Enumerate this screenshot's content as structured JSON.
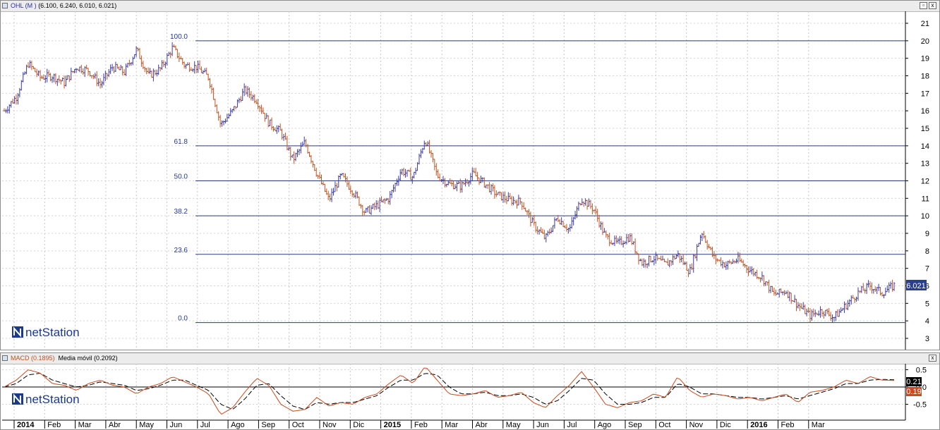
{
  "main_panel": {
    "title_symbol": "OHL (M )",
    "title_values": "(6.100, 6.240, 6.010, 6.021)",
    "last_price_badge": "6.021",
    "logo_text": "netStation",
    "y_ticks": [
      "21",
      "20",
      "19",
      "18",
      "17",
      "16",
      "15",
      "14",
      "13",
      "12",
      "11",
      "10",
      "9",
      "8",
      "7",
      "6",
      "5",
      "4",
      "3"
    ]
  },
  "macd_panel": {
    "title_macd": "MACD (0.1895)",
    "title_ma": "Media móvil (0.2092)",
    "badge_signal": "0.21",
    "badge_macd": "0.19",
    "logo_text": "netStation",
    "y_ticks": [
      "0.5",
      "0.0",
      "-0.5"
    ]
  },
  "window_buttons": {
    "restore": "▫",
    "close": "x"
  },
  "colors": {
    "up_bar": "#3a3aa8",
    "down_bar": "#c0531f",
    "fib_line": "#2b3c78",
    "macd_line": "#cc4a1c",
    "signal_line": "#000000",
    "badge": "#2b3d8f"
  },
  "chart_data": [
    {
      "type": "ohlc",
      "x_axis": "date (2014-01 to 2016-03)",
      "x_labels": [
        "2014",
        "Feb",
        "Mar",
        "Abr",
        "May",
        "Jun",
        "Jul",
        "Ago",
        "Sep",
        "Oct",
        "Nov",
        "Dic",
        "2015",
        "Feb",
        "Mar",
        "Abr",
        "May",
        "Jun",
        "Jul",
        "Ago",
        "Sep",
        "Oct",
        "Nov",
        "Dic",
        "2016",
        "Feb",
        "Mar"
      ],
      "ylim": [
        3,
        21
      ],
      "last_close": 6.021,
      "series_close": [
        16,
        16.8,
        18.7,
        17.9,
        18,
        17.6,
        18.5,
        18.3,
        17.5,
        18.5,
        18.2,
        19.5,
        18,
        18.4,
        19.6,
        18.6,
        18.5,
        17.9,
        15.2,
        16,
        17.2,
        16.6,
        15.3,
        14.8,
        13.2,
        14.2,
        12.4,
        10.9,
        12.3,
        11.4,
        10.2,
        10.6,
        11,
        12.6,
        12.2,
        14.4,
        12.3,
        11.8,
        11.7,
        12.4,
        11.8,
        11.2,
        10.9,
        10.8,
        9.5,
        8.7,
        9.9,
        9.2,
        11.0,
        10.4,
        8.8,
        8.4,
        8.8,
        7.3,
        7.6,
        7.2,
        7.8,
        6.8,
        9.1,
        7.6,
        7.2,
        7.5,
        6.9,
        6.5,
        5.5,
        5.7,
        4.9,
        4.3,
        4.6,
        4.2,
        4.9,
        5.6,
        6.0,
        5.6,
        6.021
      ],
      "fibonacci_levels": [
        {
          "label": "100.0",
          "price": 20.0
        },
        {
          "label": "61.8",
          "price": 14.0
        },
        {
          "label": "50.0",
          "price": 12.0
        },
        {
          "label": "38.2",
          "price": 10.0
        },
        {
          "label": "23.6",
          "price": 7.8
        },
        {
          "label": "0.0",
          "price": 3.9
        }
      ]
    },
    {
      "type": "line",
      "ylim": [
        -1.0,
        0.8
      ],
      "series": [
        {
          "name": "MACD (0.1895)",
          "values": [
            0.0,
            0.2,
            0.5,
            0.4,
            0.1,
            0.05,
            -0.1,
            0.1,
            0.2,
            0.05,
            0.0,
            -0.2,
            0.0,
            0.1,
            0.3,
            0.15,
            0.0,
            -0.2,
            -0.8,
            -0.6,
            -0.15,
            0.25,
            0.05,
            -0.5,
            -0.7,
            -0.65,
            -0.3,
            -0.55,
            -0.45,
            -0.5,
            -0.3,
            -0.2,
            0.1,
            0.35,
            0.1,
            0.6,
            0.2,
            -0.2,
            -0.25,
            -0.2,
            -0.1,
            -0.3,
            -0.25,
            -0.15,
            -0.45,
            -0.6,
            -0.25,
            0.05,
            0.45,
            0.0,
            -0.5,
            -0.6,
            -0.45,
            -0.4,
            -0.2,
            -0.3,
            0.3,
            -0.1,
            -0.3,
            -0.2,
            -0.25,
            -0.35,
            -0.3,
            -0.4,
            -0.3,
            -0.2,
            -0.45,
            -0.15,
            -0.1,
            0.0,
            0.2,
            0.1,
            0.3,
            0.2,
            0.19
          ]
        },
        {
          "name": "Media móvil (0.2092)",
          "values": [
            0.0,
            0.1,
            0.35,
            0.4,
            0.2,
            0.1,
            0.0,
            0.05,
            0.15,
            0.1,
            0.05,
            -0.1,
            -0.05,
            0.05,
            0.2,
            0.2,
            0.05,
            -0.1,
            -0.5,
            -0.65,
            -0.35,
            0.05,
            0.1,
            -0.25,
            -0.55,
            -0.65,
            -0.45,
            -0.5,
            -0.45,
            -0.45,
            -0.35,
            -0.25,
            0.0,
            0.2,
            0.2,
            0.4,
            0.35,
            0.0,
            -0.2,
            -0.2,
            -0.15,
            -0.25,
            -0.25,
            -0.2,
            -0.3,
            -0.5,
            -0.4,
            -0.1,
            0.25,
            0.2,
            -0.2,
            -0.5,
            -0.5,
            -0.45,
            -0.3,
            -0.3,
            0.1,
            0.0,
            -0.2,
            -0.2,
            -0.25,
            -0.3,
            -0.3,
            -0.35,
            -0.3,
            -0.25,
            -0.35,
            -0.25,
            -0.15,
            -0.05,
            0.1,
            0.1,
            0.2,
            0.22,
            0.21
          ]
        }
      ],
      "zero_line": 0.0
    }
  ]
}
